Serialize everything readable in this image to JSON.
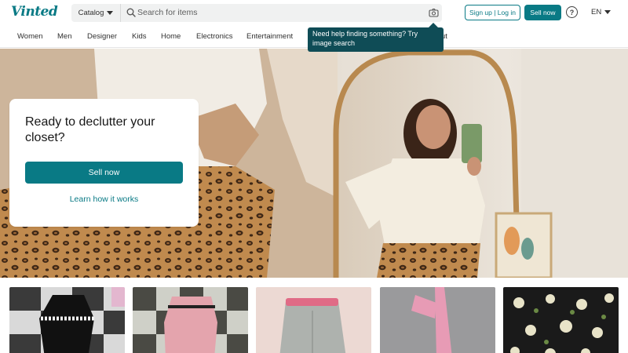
{
  "header": {
    "logo": "Vinted",
    "catalog_label": "Catalog",
    "search_placeholder": "Search for items",
    "signup_label": "Sign up | Log in",
    "sell_label": "Sell now",
    "help_glyph": "?",
    "language": "EN"
  },
  "nav": {
    "items": [
      "Women",
      "Men",
      "Designer",
      "Kids",
      "Home",
      "Electronics",
      "Entertainment",
      "ut"
    ]
  },
  "tooltip": {
    "text": "Need help finding something? Try image search"
  },
  "hero": {
    "title": "Ready to declutter your closet?",
    "cta_label": "Sell now",
    "link_label": "Learn how it works"
  },
  "colors": {
    "brand": "#097a85",
    "tooltip_bg": "#0f4c56",
    "search_bg": "#f0f1f1"
  },
  "icons": {
    "search": "search-icon",
    "camera": "camera-icon",
    "help": "help-icon",
    "caret": "chevron-down-icon"
  }
}
